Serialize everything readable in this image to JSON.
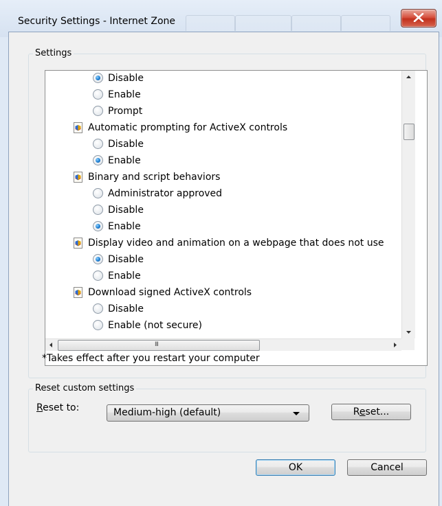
{
  "window": {
    "title": "Security Settings - Internet Zone"
  },
  "settings_group": {
    "label": "Settings"
  },
  "tree": {
    "rows": [
      {
        "kind": "radio",
        "label": "Disable",
        "checked": true
      },
      {
        "kind": "radio",
        "label": "Enable",
        "checked": false
      },
      {
        "kind": "radio",
        "label": "Prompt",
        "checked": false
      },
      {
        "kind": "category",
        "label": "Automatic prompting for ActiveX controls"
      },
      {
        "kind": "radio",
        "label": "Disable",
        "checked": false
      },
      {
        "kind": "radio",
        "label": "Enable",
        "checked": true
      },
      {
        "kind": "category",
        "label": "Binary and script behaviors"
      },
      {
        "kind": "radio",
        "label": "Administrator approved",
        "checked": false
      },
      {
        "kind": "radio",
        "label": "Disable",
        "checked": false
      },
      {
        "kind": "radio",
        "label": "Enable",
        "checked": true
      },
      {
        "kind": "category",
        "label": "Display video and animation on a webpage that does not use"
      },
      {
        "kind": "radio",
        "label": "Disable",
        "checked": true
      },
      {
        "kind": "radio",
        "label": "Enable",
        "checked": false
      },
      {
        "kind": "category",
        "label": "Download signed ActiveX controls"
      },
      {
        "kind": "radio",
        "label": "Disable",
        "checked": false
      },
      {
        "kind": "radio",
        "label": "Enable (not secure)",
        "checked": false
      }
    ],
    "hscroll_grip": "III"
  },
  "note": "*Takes effect after you restart your computer",
  "reset_group": {
    "label": "Reset custom settings",
    "reset_to_label": "Reset to:",
    "selected_level": "Medium-high (default)",
    "reset_button": "Reset..."
  },
  "footer": {
    "ok_button": "OK",
    "cancel_button": "Cancel"
  }
}
